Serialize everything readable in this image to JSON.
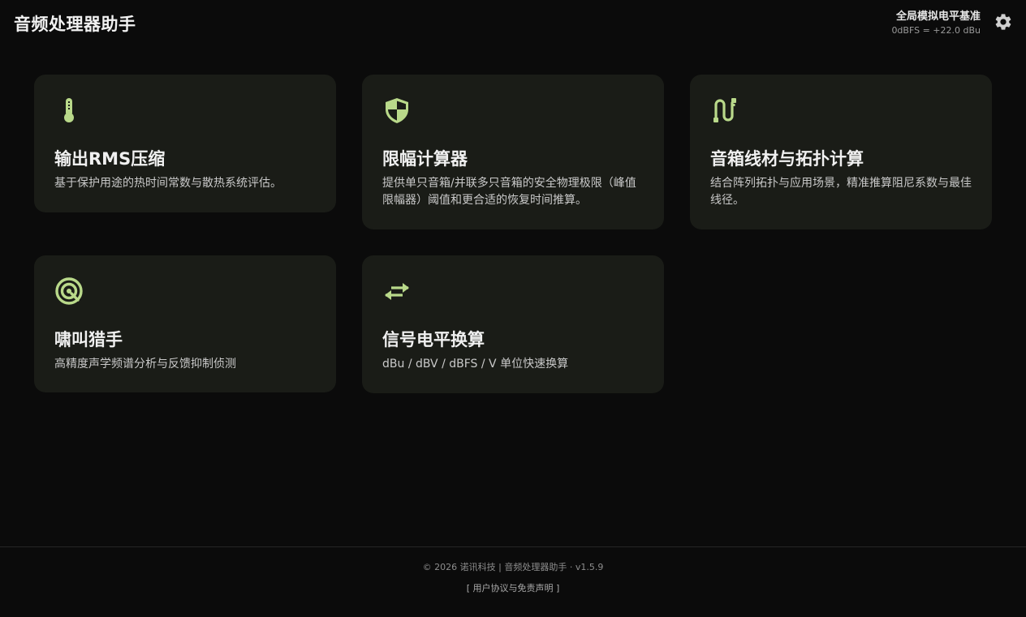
{
  "header": {
    "app_title": "音频处理器助手",
    "reference_title": "全局模拟电平基准",
    "reference_value": "0dBFS = +22.0 dBu",
    "settings_icon": "gear-icon"
  },
  "accent_color": "#b9d98a",
  "cards": [
    {
      "icon": "thermometer-icon",
      "title": "输出RMS压缩",
      "description": "基于保护用途的热时间常数与散热系统评估。"
    },
    {
      "icon": "shield-icon",
      "title": "限幅计算器",
      "description": "提供单只音箱/并联多只音箱的安全物理极限（峰值限幅器）阈值和更合适的恢复时间推算。"
    },
    {
      "icon": "cable-icon",
      "title": "音箱线材与拓扑计算",
      "description": "结合阵列拓扑与应用场景，精准推算阻尼系数与最佳线径。"
    },
    {
      "icon": "feedback-target-icon",
      "title": "啸叫猎手",
      "description": "高精度声学频谱分析与反馈抑制侦测"
    },
    {
      "icon": "swap-arrows-icon",
      "title": "信号电平换算",
      "description": "dBu / dBV / dBFS / V 单位快速换算"
    }
  ],
  "footer": {
    "copyright": "© 2026 诺讯科技 | 音频处理器助手 · v1.5.9",
    "terms_link": "[ 用户协议与免责声明 ]"
  }
}
